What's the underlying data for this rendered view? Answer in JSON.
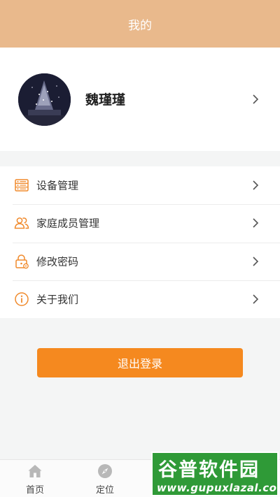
{
  "header": {
    "title": "我的"
  },
  "profile": {
    "name": "魏瑾瑾"
  },
  "menu": {
    "items": [
      {
        "label": "设备管理",
        "icon": "device-list-icon"
      },
      {
        "label": "家庭成员管理",
        "icon": "family-members-icon"
      },
      {
        "label": "修改密码",
        "icon": "lock-icon"
      },
      {
        "label": "关于我们",
        "icon": "info-icon"
      }
    ]
  },
  "logout": {
    "label": "退出登录"
  },
  "tabbar": {
    "tabs": [
      {
        "label": "首页",
        "icon": "home-icon"
      },
      {
        "label": "定位",
        "icon": "compass-icon"
      }
    ]
  },
  "watermark": {
    "title": "谷普软件园",
    "url": "www.gupuxlazal.com"
  },
  "colors": {
    "header": "#e9b98c",
    "accent": "#f5891f",
    "icon": "#f08a2c"
  }
}
